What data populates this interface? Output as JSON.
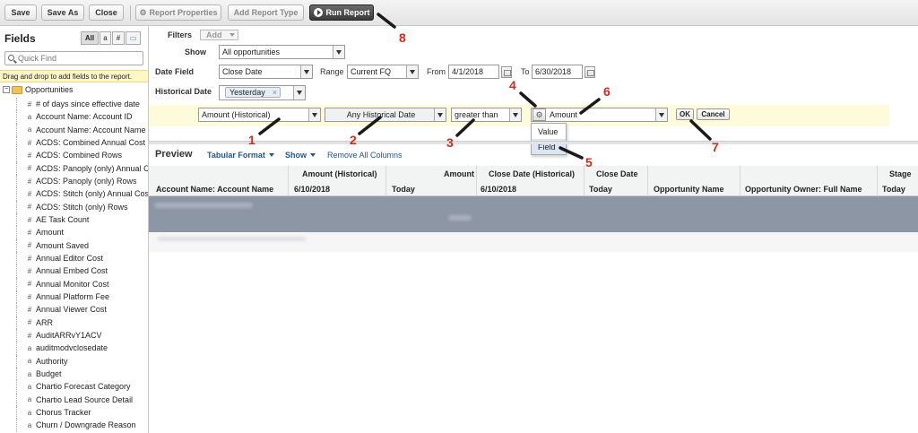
{
  "toolbar": {
    "save": "Save",
    "save_as": "Save As",
    "close": "Close",
    "report_properties": "Report Properties",
    "add_report_type": "Add Report Type",
    "run_report": "Run Report"
  },
  "sidebar": {
    "title": "Fields",
    "filters": [
      "All",
      "a",
      "#",
      "▭"
    ],
    "quick_find_placeholder": "Quick Find",
    "hint": "Drag and drop to add fields to the report.",
    "root": "Opportunities",
    "fields": [
      {
        "type": "#",
        "label": "# of days since effective date"
      },
      {
        "type": "a",
        "label": "Account Name: Account ID"
      },
      {
        "type": "a",
        "label": "Account Name: Account Name"
      },
      {
        "type": "#",
        "label": "ACDS: Combined Annual Cost"
      },
      {
        "type": "#",
        "label": "ACDS: Combined Rows"
      },
      {
        "type": "#",
        "label": "ACDS: Panoply (only) Annual C"
      },
      {
        "type": "#",
        "label": "ACDS: Panoply (only) Rows"
      },
      {
        "type": "#",
        "label": "ACDS: Stitch (only) Annual Cos"
      },
      {
        "type": "#",
        "label": "ACDS: Stitch (only) Rows"
      },
      {
        "type": "#",
        "label": "AE Task Count"
      },
      {
        "type": "#",
        "label": "Amount"
      },
      {
        "type": "#",
        "label": "Amount Saved"
      },
      {
        "type": "#",
        "label": "Annual Editor Cost"
      },
      {
        "type": "#",
        "label": "Annual Embed Cost"
      },
      {
        "type": "#",
        "label": "Annual Monitor Cost"
      },
      {
        "type": "#",
        "label": "Annual Platform Fee"
      },
      {
        "type": "#",
        "label": "Annual Viewer Cost"
      },
      {
        "type": "#",
        "label": "ARR"
      },
      {
        "type": "#",
        "label": "AuditARRvY1ACV"
      },
      {
        "type": "a",
        "label": "auditmodvclosedate"
      },
      {
        "type": "a",
        "label": "Authority"
      },
      {
        "type": "a",
        "label": "Budget"
      },
      {
        "type": "a",
        "label": "Chartio Forecast Category"
      },
      {
        "type": "a",
        "label": "Chartio Lead Source Detail"
      },
      {
        "type": "a",
        "label": "Chorus Tracker"
      },
      {
        "type": "a",
        "label": "Churn / Downgrade Reason"
      }
    ]
  },
  "filters": {
    "label": "Filters",
    "add": "Add",
    "show_label": "Show",
    "show_value": "All opportunities",
    "date_field_label": "Date Field",
    "date_field_value": "Close Date",
    "range_label": "Range",
    "range_value": "Current FQ",
    "from_label": "From",
    "from_value": "4/1/2018",
    "to_label": "To",
    "to_value": "6/30/2018",
    "historical_label": "Historical Date",
    "historical_value": "Yesterday",
    "chip_close": "×"
  },
  "criteria": {
    "field": "Amount (Historical)",
    "historical_date": "Any Historical Date",
    "operator": "greater than",
    "gear": "⚙",
    "value": "Amount",
    "ok": "OK",
    "cancel": "Cancel",
    "dropdown": [
      "Value",
      "Field"
    ]
  },
  "preview": {
    "title": "Preview",
    "format": "Tabular Format",
    "show": "Show",
    "remove_all": "Remove All Columns",
    "columns": [
      {
        "top": "",
        "bottom": "Account Name: Account Name"
      },
      {
        "top": "Amount (Historical)",
        "bottom": "6/10/2018"
      },
      {
        "top": "Amount",
        "bottom": "Today"
      },
      {
        "top": "Close Date (Historical)",
        "bottom": "6/10/2018"
      },
      {
        "top": "Close Date",
        "bottom": "Today"
      },
      {
        "top": "",
        "bottom": "Opportunity Name"
      },
      {
        "top": "",
        "bottom": "Opportunity Owner: Full Name"
      },
      {
        "top": "Stage",
        "bottom": "Today"
      }
    ]
  },
  "callouts": [
    "1",
    "2",
    "3",
    "4",
    "5",
    "6",
    "7",
    "8"
  ],
  "colors": {
    "callout": "#d42a1a",
    "link": "#22559c",
    "highlight": "#fdfbd9"
  }
}
